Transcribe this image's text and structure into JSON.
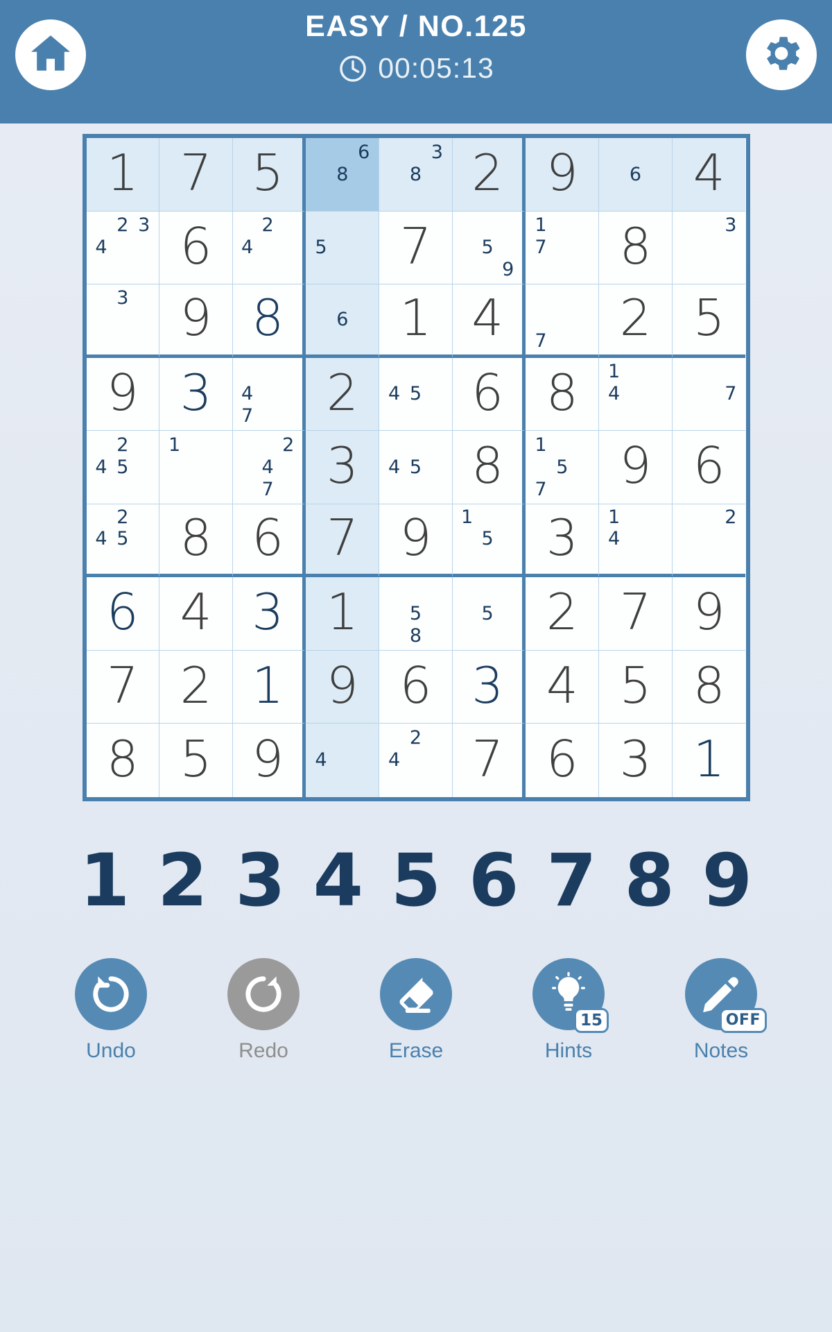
{
  "header": {
    "title": "EASY / NO.125",
    "timer": "00:05:13",
    "home_icon": "home-icon",
    "settings_icon": "gear-icon",
    "clock_icon": "clock-icon",
    "bar_color": "#4a80ad"
  },
  "board": {
    "selected": {
      "row": 0,
      "col": 3
    },
    "highlight_row": 0,
    "highlight_col": 3,
    "colors": {
      "given": "#3f3f3f",
      "user": "#1b3c5e",
      "note": "#1b3c5e",
      "grid_line": "#4a80ad",
      "cell_line": "#b9d4e8",
      "highlight": "#dcebf6",
      "selected": "#a6cbe6"
    },
    "cells": [
      [
        {
          "value": "1",
          "kind": "given"
        },
        {
          "value": "7",
          "kind": "given"
        },
        {
          "value": "5",
          "kind": "given"
        },
        {
          "notes": [
            null,
            null,
            "6",
            null,
            "8",
            null,
            null,
            null,
            null
          ]
        },
        {
          "notes": [
            null,
            null,
            "3",
            null,
            "8",
            null,
            null,
            null,
            null
          ]
        },
        {
          "value": "2",
          "kind": "given"
        },
        {
          "value": "9",
          "kind": "given"
        },
        {
          "notes": [
            null,
            null,
            null,
            null,
            "6",
            null,
            null,
            null,
            null
          ]
        },
        {
          "value": "4",
          "kind": "given"
        }
      ],
      [
        {
          "notes": [
            null,
            "2",
            "3",
            "4",
            null,
            null,
            null,
            null,
            null
          ]
        },
        {
          "value": "6",
          "kind": "given"
        },
        {
          "notes": [
            null,
            "2",
            null,
            "4",
            null,
            null,
            null,
            null,
            null
          ]
        },
        {
          "notes": [
            null,
            null,
            null,
            "5",
            null,
            null,
            null,
            null,
            null
          ]
        },
        {
          "value": "7",
          "kind": "given"
        },
        {
          "notes": [
            null,
            null,
            null,
            null,
            "5",
            null,
            null,
            null,
            "9"
          ]
        },
        {
          "notes": [
            "1",
            null,
            null,
            "7",
            null,
            null,
            null,
            null,
            null
          ]
        },
        {
          "value": "8",
          "kind": "given"
        },
        {
          "notes": [
            null,
            null,
            "3",
            null,
            null,
            null,
            null,
            null,
            null
          ]
        }
      ],
      [
        {
          "notes": [
            null,
            "3",
            null,
            null,
            null,
            null,
            null,
            null,
            null
          ]
        },
        {
          "value": "9",
          "kind": "given"
        },
        {
          "value": "8",
          "kind": "user"
        },
        {
          "notes": [
            null,
            null,
            null,
            null,
            "6",
            null,
            null,
            null,
            null
          ]
        },
        {
          "value": "1",
          "kind": "given"
        },
        {
          "value": "4",
          "kind": "given"
        },
        {
          "notes": [
            null,
            null,
            null,
            null,
            null,
            null,
            "7",
            null,
            null
          ]
        },
        {
          "value": "2",
          "kind": "given"
        },
        {
          "value": "5",
          "kind": "given"
        }
      ],
      [
        {
          "value": "9",
          "kind": "given"
        },
        {
          "value": "3",
          "kind": "user"
        },
        {
          "notes": [
            null,
            null,
            null,
            "4",
            null,
            null,
            "7",
            null,
            null
          ]
        },
        {
          "value": "2",
          "kind": "given"
        },
        {
          "notes": [
            null,
            null,
            null,
            "4",
            "5",
            null,
            null,
            null,
            null
          ]
        },
        {
          "value": "6",
          "kind": "given"
        },
        {
          "value": "8",
          "kind": "given"
        },
        {
          "notes": [
            "1",
            null,
            null,
            "4",
            null,
            null,
            null,
            null,
            null
          ]
        },
        {
          "notes": [
            null,
            null,
            null,
            null,
            null,
            "7",
            null,
            null,
            null
          ]
        }
      ],
      [
        {
          "notes": [
            null,
            "2",
            null,
            "4",
            "5",
            null,
            null,
            null,
            null
          ]
        },
        {
          "notes": [
            "1",
            null,
            null,
            null,
            null,
            null,
            null,
            null,
            null
          ]
        },
        {
          "notes": [
            null,
            null,
            "2",
            null,
            "4",
            null,
            null,
            "7",
            null
          ]
        },
        {
          "value": "3",
          "kind": "given"
        },
        {
          "notes": [
            null,
            null,
            null,
            "4",
            "5",
            null,
            null,
            null,
            null
          ]
        },
        {
          "value": "8",
          "kind": "given"
        },
        {
          "notes": [
            "1",
            null,
            null,
            null,
            "5",
            null,
            "7",
            null,
            null
          ]
        },
        {
          "value": "9",
          "kind": "given"
        },
        {
          "value": "6",
          "kind": "given"
        }
      ],
      [
        {
          "notes": [
            null,
            "2",
            null,
            "4",
            "5",
            null,
            null,
            null,
            null
          ]
        },
        {
          "value": "8",
          "kind": "given"
        },
        {
          "value": "6",
          "kind": "given"
        },
        {
          "value": "7",
          "kind": "given"
        },
        {
          "value": "9",
          "kind": "given"
        },
        {
          "notes": [
            "1",
            null,
            null,
            null,
            "5",
            null,
            null,
            null,
            null
          ]
        },
        {
          "value": "3",
          "kind": "given"
        },
        {
          "notes": [
            "1",
            null,
            null,
            "4",
            null,
            null,
            null,
            null,
            null
          ]
        },
        {
          "notes": [
            null,
            null,
            "2",
            null,
            null,
            null,
            null,
            null,
            null
          ]
        }
      ],
      [
        {
          "value": "6",
          "kind": "user"
        },
        {
          "value": "4",
          "kind": "given"
        },
        {
          "value": "3",
          "kind": "user"
        },
        {
          "value": "1",
          "kind": "given"
        },
        {
          "notes": [
            null,
            null,
            null,
            null,
            "5",
            null,
            null,
            "8",
            null
          ]
        },
        {
          "notes": [
            null,
            null,
            null,
            null,
            "5",
            null,
            null,
            null,
            null
          ]
        },
        {
          "value": "2",
          "kind": "given"
        },
        {
          "value": "7",
          "kind": "given"
        },
        {
          "value": "9",
          "kind": "given"
        }
      ],
      [
        {
          "value": "7",
          "kind": "given"
        },
        {
          "value": "2",
          "kind": "given"
        },
        {
          "value": "1",
          "kind": "user"
        },
        {
          "value": "9",
          "kind": "given"
        },
        {
          "value": "6",
          "kind": "given"
        },
        {
          "value": "3",
          "kind": "user"
        },
        {
          "value": "4",
          "kind": "given"
        },
        {
          "value": "5",
          "kind": "given"
        },
        {
          "value": "8",
          "kind": "given"
        }
      ],
      [
        {
          "value": "8",
          "kind": "given"
        },
        {
          "value": "5",
          "kind": "given"
        },
        {
          "value": "9",
          "kind": "given"
        },
        {
          "notes": [
            null,
            null,
            null,
            "4",
            null,
            null,
            null,
            null,
            null
          ]
        },
        {
          "notes": [
            null,
            "2",
            null,
            "4",
            null,
            null,
            null,
            null,
            null
          ]
        },
        {
          "value": "7",
          "kind": "given"
        },
        {
          "value": "6",
          "kind": "given"
        },
        {
          "value": "3",
          "kind": "given"
        },
        {
          "value": "1",
          "kind": "user"
        }
      ]
    ]
  },
  "numpad": [
    "1",
    "2",
    "3",
    "4",
    "5",
    "6",
    "7",
    "8",
    "9"
  ],
  "actions": [
    {
      "label": "Undo",
      "icon": "undo-icon",
      "disabled": false,
      "badge": null
    },
    {
      "label": "Redo",
      "icon": "redo-icon",
      "disabled": true,
      "badge": null
    },
    {
      "label": "Erase",
      "icon": "eraser-icon",
      "disabled": false,
      "badge": null
    },
    {
      "label": "Hints",
      "icon": "lightbulb-icon",
      "disabled": false,
      "badge": "15"
    },
    {
      "label": "Notes",
      "icon": "pencil-icon",
      "disabled": false,
      "badge": "OFF"
    }
  ]
}
